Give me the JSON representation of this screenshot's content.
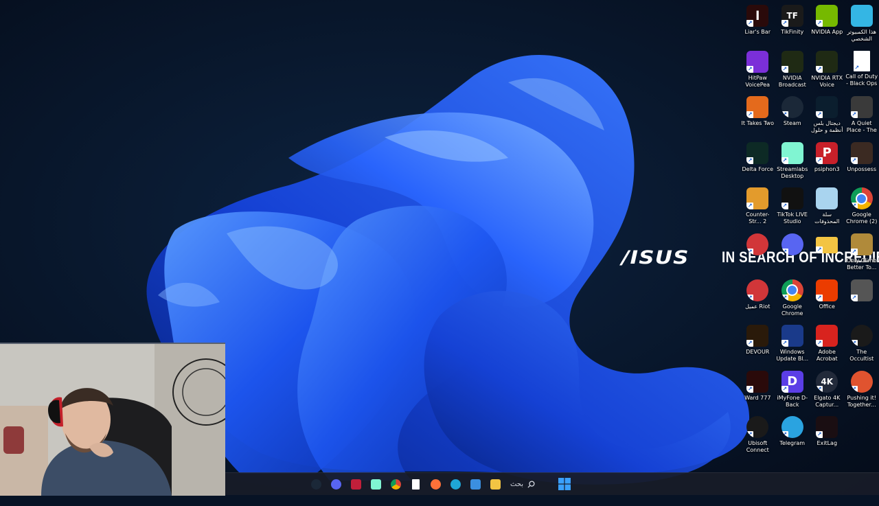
{
  "wallpaper": {
    "brand_logo": "/ISUS",
    "brand_tagline": "IN SEARCH OF INCREDIBLE",
    "colors": {
      "background": "#071325",
      "bloom": "#1b4fe6",
      "bloom_highlight": "#4f8bff"
    }
  },
  "desktop_icons": [
    {
      "label": "هذا الكمبيوتر الشخصي",
      "icon": "monitor-icon",
      "color": "#34b6e4"
    },
    {
      "label": "NVIDIA App",
      "icon": "nvidia-icon",
      "color": "#76b900"
    },
    {
      "label": "TikFinity",
      "icon": "tikfinity-icon",
      "color": "#1a1a1a",
      "glyph": "TF"
    },
    {
      "label": "Liar's Bar",
      "icon": "liars-bar-icon",
      "color": "#2a0a0a",
      "glyph": "l"
    },
    {
      "label": "Call of Duty - Black Ops 6",
      "icon": "file-shortcut-icon",
      "color": "#ffffff"
    },
    {
      "label": "NVIDIA RTX Voice",
      "icon": "nvidia-rtx-voice-icon",
      "color": "#1f2a14"
    },
    {
      "label": "NVIDIA Broadcast",
      "icon": "nvidia-broadcast-icon",
      "color": "#1f2a14"
    },
    {
      "label": "HitPaw VoicePea",
      "icon": "hitpaw-icon",
      "color": "#7b2fd8"
    },
    {
      "label": "A Quiet Place - The Road ...",
      "icon": "game-shield-icon",
      "color": "#3a3a3a"
    },
    {
      "label": "ديجتال بلس أنظمة و حلول",
      "icon": "digital-plus-icon",
      "color": "#0b1e2e"
    },
    {
      "label": "Steam",
      "icon": "steam-icon",
      "color": "#1b2838"
    },
    {
      "label": "It Takes Two",
      "icon": "it-takes-two-icon",
      "color": "#e46a1c"
    },
    {
      "label": "Unpossess",
      "icon": "unpossess-icon",
      "color": "#3b2a22"
    },
    {
      "label": "psiphon3",
      "icon": "psiphon-icon",
      "color": "#c8202a",
      "glyph": "P"
    },
    {
      "label": "Streamlabs Desktop",
      "icon": "streamlabs-icon",
      "color": "#80f5d2"
    },
    {
      "label": "Delta Force",
      "icon": "delta-force-icon",
      "color": "#0d2a25"
    },
    {
      "label": "Google Chrome (2)",
      "icon": "chrome-icon",
      "color": "#ffffff"
    },
    {
      "label": "سلة المحذوفات",
      "icon": "recycle-bin-icon",
      "color": "#a9d4ef"
    },
    {
      "label": "TikTok LIVE Studio",
      "icon": "tiktok-icon",
      "color": "#111111"
    },
    {
      "label": "Counter-Str... 2",
      "icon": "counter-strike-icon",
      "color": "#e39b2c"
    },
    {
      "label": "Only Climb Better To...",
      "icon": "only-climb-icon",
      "color": "#b08a3a"
    },
    {
      "label": "",
      "icon": "folder-icon",
      "color": "#f3c443"
    },
    {
      "label": "",
      "icon": "discord-icon",
      "color": "#5865f2"
    },
    {
      "label": "",
      "icon": "riot-client-icon",
      "color": "#d13639"
    },
    {
      "label": "",
      "icon": "game-icon",
      "color": "#555555"
    },
    {
      "label": "Office",
      "icon": "office-icon",
      "color": "#eb3c00"
    },
    {
      "label": "Google Chrome",
      "icon": "chrome-icon",
      "color": "#ffffff"
    },
    {
      "label": "عميل Riot",
      "icon": "riot-client-icon",
      "color": "#d13639"
    },
    {
      "label": "The Occultist",
      "icon": "occultist-icon",
      "color": "#1a1a1a"
    },
    {
      "label": "Adobe Acrobat",
      "icon": "acrobat-icon",
      "color": "#d8231e"
    },
    {
      "label": "Windows Update Bl...",
      "icon": "windows-update-blocker-icon",
      "color": "#1a3a8a"
    },
    {
      "label": "DEVOUR",
      "icon": "devour-icon",
      "color": "#2a1a0a"
    },
    {
      "label": "Pushing it! Together...",
      "icon": "pushing-it-icon",
      "color": "#e0532f"
    },
    {
      "label": "Elgato 4K Captur...",
      "icon": "elgato-4k-icon",
      "color": "#222a3a",
      "glyph": "4K"
    },
    {
      "label": "iMyFone D-Back",
      "icon": "imyfone-icon",
      "color": "#5b3ee6",
      "glyph": "D"
    },
    {
      "label": "Ward 777",
      "icon": "ward-777-icon",
      "color": "#2a0a0a"
    },
    {
      "label": "",
      "icon": "",
      "color": ""
    },
    {
      "label": "ExitLag",
      "icon": "exitlag-icon",
      "color": "#1a0e12"
    },
    {
      "label": "Telegram",
      "icon": "telegram-icon",
      "color": "#2aa3e0"
    },
    {
      "label": "Ubisoft Connect",
      "icon": "ubisoft-icon",
      "color": "#1a1a1a"
    },
    {
      "label": "",
      "icon": "",
      "color": ""
    }
  ],
  "taskbar": {
    "search_label": "بحث",
    "apps": [
      {
        "name": "steam-taskbar-icon",
        "color": "#1b2838"
      },
      {
        "name": "discord-taskbar-icon",
        "color": "#5865f2"
      },
      {
        "name": "exitlag-taskbar-icon",
        "color": "#c21f3a"
      },
      {
        "name": "streamlabs-taskbar-icon",
        "color": "#80f5d2"
      },
      {
        "name": "chrome-taskbar-icon",
        "color": "#ffffff"
      },
      {
        "name": "file-taskbar-icon",
        "color": "#ffffff"
      },
      {
        "name": "firefox-taskbar-icon",
        "color": "#ff7139"
      },
      {
        "name": "edge-taskbar-icon",
        "color": "#1fa6d6"
      },
      {
        "name": "store-taskbar-icon",
        "color": "#3b8fe0"
      },
      {
        "name": "file-explorer-taskbar-icon",
        "color": "#f3c443"
      }
    ]
  }
}
